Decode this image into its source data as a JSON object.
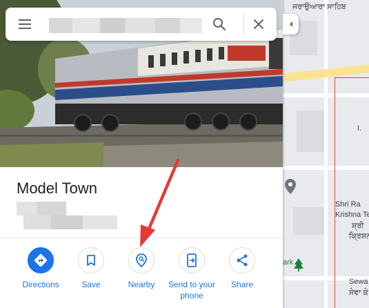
{
  "search": {
    "value": "",
    "placeholder": ""
  },
  "icons": {
    "menu": "hamburger-menu-icon",
    "search": "magnifier-icon",
    "close": "x-close-icon",
    "collapse": "caret-left-icon",
    "directions": "diamond-turn-arrow-icon",
    "save": "bookmark-icon",
    "nearby": "location-pin-search-icon",
    "send": "phone-send-icon",
    "share": "share-nodes-icon",
    "map_pin": "gray-map-pin-icon",
    "park_marker": "green-tree-icon"
  },
  "place": {
    "title": "Model Town"
  },
  "actions": [
    {
      "label": "Directions"
    },
    {
      "label": "Save"
    },
    {
      "label": "Nearby"
    },
    {
      "label": "Send to your phone"
    },
    {
      "label": "Share"
    }
  ],
  "map": {
    "label_top": "ਜਰਾਉਆਰਾ ਸਾਹਿਬ",
    "label_i": "I.",
    "label_temple1": "Shri Ra",
    "label_temple2": "Krishna Tem",
    "label_temple3": "ਸ਼੍ਰੀ",
    "label_temple4": "ਕ੍ਰਿਸ਼ਨ",
    "label_park": "ark",
    "label_sewa1": "Sewa Ke",
    "label_sewa2": "ਸੇਵਾ ਕੇ"
  },
  "colors": {
    "accent": "#1a73e8",
    "annotation_arrow": "#e53935",
    "map_background": "#e8eaed",
    "highway": "#fde293",
    "boundary": "#ea4335"
  }
}
